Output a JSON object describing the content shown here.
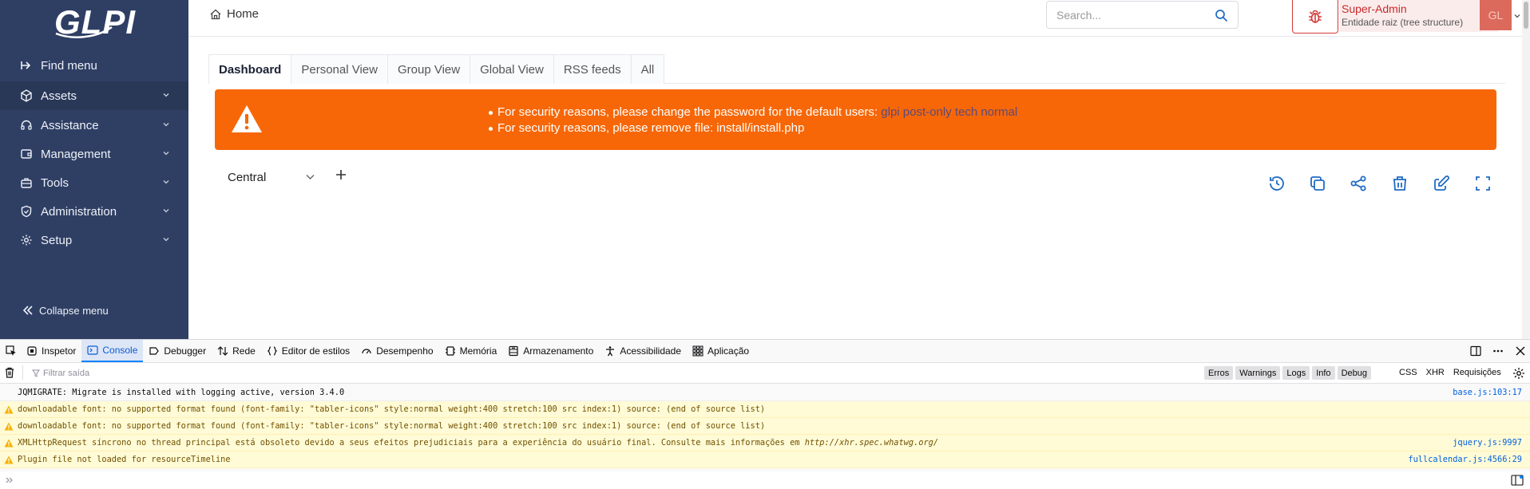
{
  "app": {
    "logo_text": "GLPI",
    "sidebar": {
      "items": [
        {
          "label": "Find menu",
          "icon": "arrow-right-icon",
          "chevron": false
        },
        {
          "label": "Assets",
          "icon": "box-icon",
          "chevron": true
        },
        {
          "label": "Assistance",
          "icon": "headset-icon",
          "chevron": true
        },
        {
          "label": "Management",
          "icon": "wallet-icon",
          "chevron": true
        },
        {
          "label": "Tools",
          "icon": "briefcase-icon",
          "chevron": true
        },
        {
          "label": "Administration",
          "icon": "shield-icon",
          "chevron": true
        },
        {
          "label": "Setup",
          "icon": "gear-icon",
          "chevron": true
        }
      ],
      "collapse_label": "Collapse menu"
    },
    "breadcrumb": {
      "label": "Home"
    },
    "search": {
      "placeholder": "Search..."
    },
    "user": {
      "name": "Super-Admin",
      "entity": "Entidade raiz (tree structure)",
      "initials": "GL"
    },
    "tabs": [
      "Dashboard",
      "Personal View",
      "Group View",
      "Global View",
      "RSS feeds",
      "All"
    ],
    "active_tab": "Dashboard",
    "alert": {
      "line1_prefix": "For security reasons, please change the password for the default users:",
      "line1_users": "glpi post-only tech normal",
      "line2": "For security reasons, please remove file: install/install.php"
    },
    "dashboard": {
      "selected": "Central",
      "actions": [
        "history-icon",
        "copy-icon",
        "share-icon",
        "trash-icon",
        "edit-icon",
        "fullscreen-icon"
      ]
    },
    "colors": {
      "sidebar": "#2f3f64",
      "alert": "#f76707",
      "accent": "#0a84ff",
      "danger": "#d63939"
    }
  },
  "devtools": {
    "tabs": [
      {
        "label": "Inspetor",
        "icon": "inspector-icon"
      },
      {
        "label": "Console",
        "icon": "console-icon"
      },
      {
        "label": "Debugger",
        "icon": "debugger-icon"
      },
      {
        "label": "Rede",
        "icon": "network-icon"
      },
      {
        "label": "Editor de estilos",
        "icon": "braces-icon"
      },
      {
        "label": "Desempenho",
        "icon": "gauge-icon"
      },
      {
        "label": "Memória",
        "icon": "memory-icon"
      },
      {
        "label": "Armazenamento",
        "icon": "storage-icon"
      },
      {
        "label": "Acessibilidade",
        "icon": "accessibility-icon"
      },
      {
        "label": "Aplicação",
        "icon": "grid-icon"
      }
    ],
    "active_tab": "Console",
    "filter_placeholder": "Filtrar saída",
    "levels": [
      "Erros",
      "Warnings",
      "Logs",
      "Info",
      "Debug"
    ],
    "net_filters": [
      "CSS",
      "XHR",
      "Requisições"
    ],
    "logs": [
      {
        "level": "log",
        "message": "JQMIGRATE: Migrate is installed with logging active, version 3.4.0",
        "source": "base.js:103:17"
      },
      {
        "level": "warn",
        "message": "downloadable font: no supported format found (font-family: \"tabler-icons\" style:normal weight:400 stretch:100 src index:1) source: (end of source list)",
        "source": ""
      },
      {
        "level": "warn",
        "message": "downloadable font: no supported format found (font-family: \"tabler-icons\" style:normal weight:400 stretch:100 src index:1) source: (end of source list)",
        "source": ""
      },
      {
        "level": "warn",
        "message": "XMLHttpRequest síncrono no thread principal está obsoleto devido a seus efeitos prejudiciais para a experiência do usuário final. Consulte mais informações em ",
        "link": "http://xhr.spec.whatwg.org/",
        "source": "jquery.js:9997"
      },
      {
        "level": "warn",
        "message": "Plugin file not loaded for resourceTimeline",
        "source": "fullcalendar.js:4566:29"
      }
    ]
  }
}
